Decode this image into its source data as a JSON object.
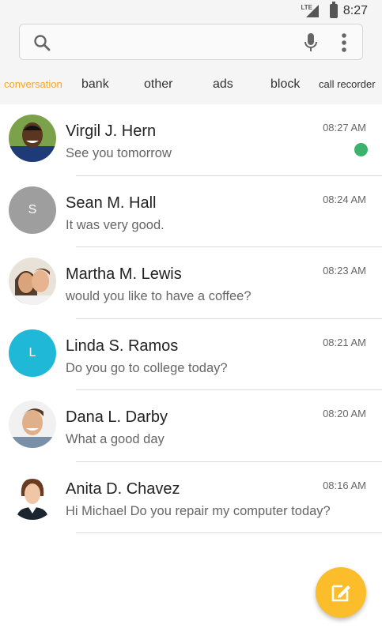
{
  "status_bar": {
    "network": "LTE",
    "time": "8:27"
  },
  "search": {
    "placeholder": ""
  },
  "tabs": [
    {
      "label": "conversation",
      "active": true
    },
    {
      "label": "bank"
    },
    {
      "label": "other"
    },
    {
      "label": "ads"
    },
    {
      "label": "block"
    },
    {
      "label": "call recorder"
    }
  ],
  "conversations": [
    {
      "name": "Virgil J. Hern",
      "message": "See you tomorrow",
      "time": "08:27 AM",
      "unread": true,
      "avatar": "photo"
    },
    {
      "name": "Sean M. Hall",
      "message": "It was very good.",
      "time": "08:24 AM",
      "avatar": "letter",
      "initial": "S",
      "color": "#9e9e9e"
    },
    {
      "name": "Martha M. Lewis",
      "message": "would you like to have a coffee?",
      "time": "08:23 AM",
      "avatar": "photo"
    },
    {
      "name": "Linda S. Ramos",
      "message": "Do you go to college today?",
      "time": "08:21 AM",
      "avatar": "letter",
      "initial": "L",
      "color": "#1fb8d6"
    },
    {
      "name": "Dana L. Darby",
      "message": "What a good day",
      "time": "08:20 AM",
      "avatar": "photo"
    },
    {
      "name": "Anita D. Chavez",
      "message": "Hi Michael Do you repair my computer today?",
      "time": "08:16 AM",
      "avatar": "photo"
    }
  ],
  "colors": {
    "accent": "#f5a623",
    "fab": "#fbbd2a",
    "unread_dot": "#3cb36c"
  },
  "fab": {
    "icon": "compose-icon"
  }
}
